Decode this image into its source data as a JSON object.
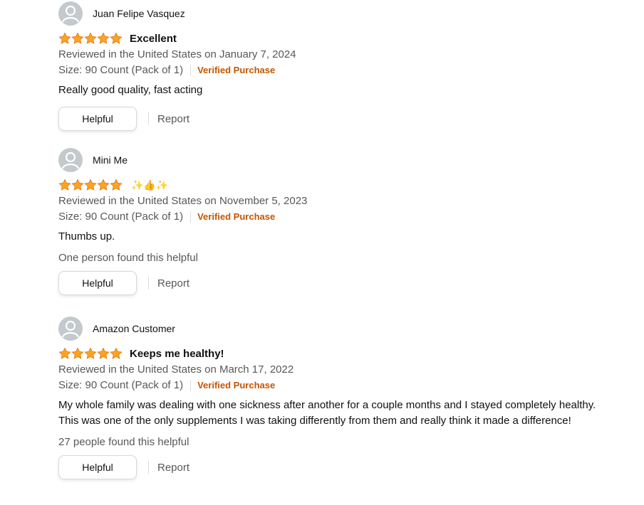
{
  "colors": {
    "star": "#FFA41C",
    "star_outline": "#DE7921",
    "verified": "#C45500",
    "meta_text": "#565959",
    "avatar_bg": "#C3C9CC"
  },
  "reviews": [
    {
      "reviewer": "Juan Felipe Vasquez",
      "rating": 5,
      "title": "Excellent",
      "date_line": "Reviewed in the United States on January 7, 2024",
      "size": "Size: 90 Count (Pack of 1)",
      "verified": "Verified Purchase",
      "body": "Really good quality, fast acting",
      "helpful_count": "",
      "helpful_label": "Helpful",
      "report_label": "Report"
    },
    {
      "reviewer": "Mini Me",
      "rating": 5,
      "title": "✨👍✨",
      "date_line": "Reviewed in the United States on November 5, 2023",
      "size": "Size: 90 Count (Pack of 1)",
      "verified": "Verified Purchase",
      "body": "Thumbs up.",
      "helpful_count": "One person found this helpful",
      "helpful_label": "Helpful",
      "report_label": "Report"
    },
    {
      "reviewer": "Amazon Customer",
      "rating": 5,
      "title": "Keeps me healthy!",
      "date_line": "Reviewed in the United States on March 17, 2022",
      "size": "Size: 90 Count (Pack of 1)",
      "verified": "Verified Purchase",
      "body": "My whole family was dealing with one sickness after another for a couple months and I stayed completely healthy. This was one of the only supplements I was taking differently from them and really think it made a difference!",
      "helpful_count": "27 people found this helpful",
      "helpful_label": "Helpful",
      "report_label": "Report"
    }
  ]
}
